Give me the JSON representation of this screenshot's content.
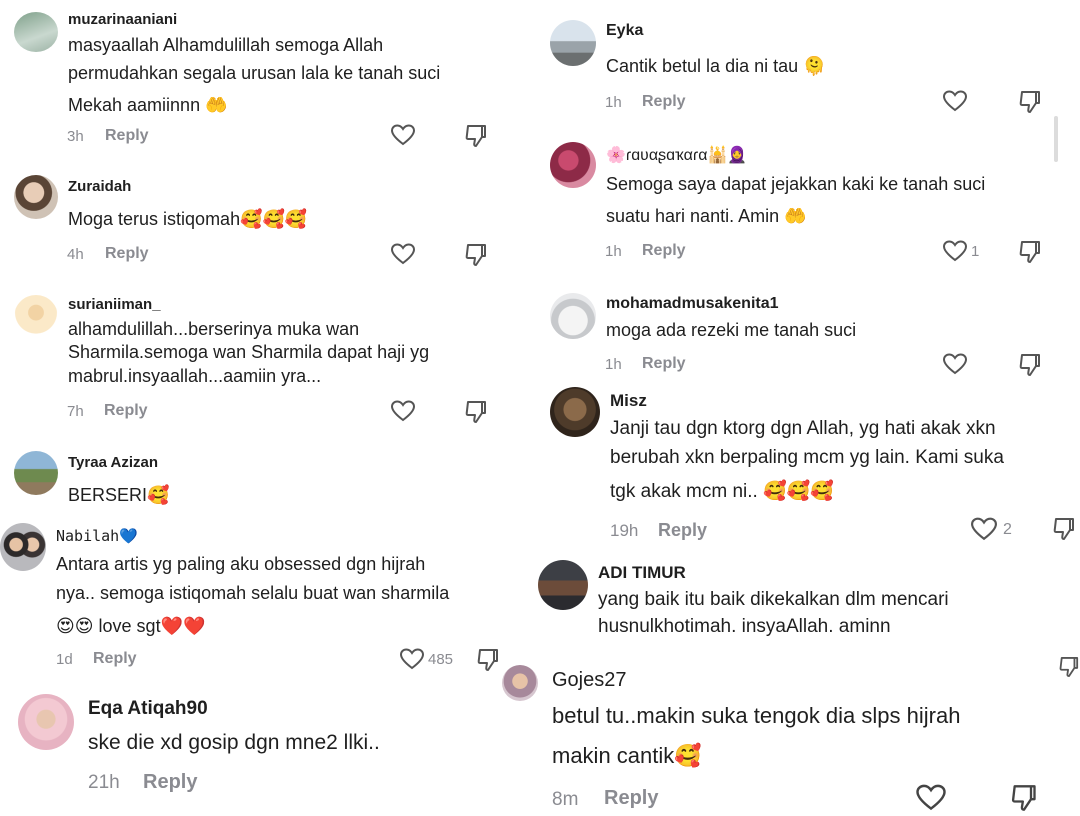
{
  "left": [
    {
      "username": "muzarinaaniani",
      "lines": [
        "masyaallah Alhamdulillah semoga Allah",
        "permudahkan segala urusan lala ke tanah suci",
        "Mekah aamiinnn 🤲"
      ],
      "time": "3h",
      "reply": "Reply",
      "likes": ""
    },
    {
      "username": "Zuraidah",
      "lines": [
        "Moga terus istiqomah🥰🥰🥰"
      ],
      "time": "4h",
      "reply": "Reply",
      "likes": ""
    },
    {
      "username": "surianiiman_",
      "lines": [
        "alhamdulillah...berserinya muka wan",
        "Sharmila.semoga wan Sharmila dapat haji yg",
        "mabrul.insyaallah...aamiin yra..."
      ],
      "time": "7h",
      "reply": "Reply",
      "likes": ""
    },
    {
      "username": "Tyraa Azizan",
      "lines": [
        "BERSERI🥰"
      ],
      "time": "",
      "reply": "",
      "likes": ""
    },
    {
      "username": "Nabilah💙",
      "lines": [
        "Antara artis yg paling aku obsessed dgn hijrah",
        "nya.. semoga istiqomah selalu buat wan sharmila",
        "😍😍 love sgt❤️❤️"
      ],
      "time": "1d",
      "reply": "Reply",
      "likes": "485"
    },
    {
      "username": "Eqa Atiqah90",
      "lines": [
        "ske die xd gosip dgn mne2 llki.."
      ],
      "time": "21h",
      "reply": "Reply",
      "likes": ""
    }
  ],
  "right": [
    {
      "username": "Eyka",
      "lines": [
        "Cantik betul la dia ni tau 🫠"
      ],
      "time": "1h",
      "reply": "Reply",
      "likes": ""
    },
    {
      "username": "🌸ɾɑʋαʂɑҡαɾα🕌🧕",
      "lines": [
        "Semoga saya dapat jejakkan kaki ke tanah suci",
        "suatu hari nanti. Amin 🤲"
      ],
      "time": "1h",
      "reply": "Reply",
      "likes": "1"
    },
    {
      "username": "mohamadmusakenita1",
      "lines": [
        "moga ada rezeki me tanah suci"
      ],
      "time": "1h",
      "reply": "Reply",
      "likes": ""
    },
    {
      "username": "Misz",
      "lines": [
        "Janji tau dgn ktorg dgn Allah, yg hati akak xkn",
        "berubah xkn berpaling mcm yg lain. Kami suka",
        "tgk akak mcm ni.. 🥰🥰🥰"
      ],
      "time": "19h",
      "reply": "Reply",
      "likes": "2"
    },
    {
      "username": "ADI TIMUR",
      "lines": [
        "yang baik itu baik dikekalkan dlm mencari",
        "husnulkhotimah. insyaAllah. aminn"
      ],
      "time": "",
      "reply": "",
      "likes": ""
    },
    {
      "username": "Gojes27",
      "lines": [
        "betul tu..makin suka tengok dia slps hijrah",
        "makin cantik🥰"
      ],
      "time": "8m",
      "reply": "Reply",
      "likes": ""
    }
  ]
}
